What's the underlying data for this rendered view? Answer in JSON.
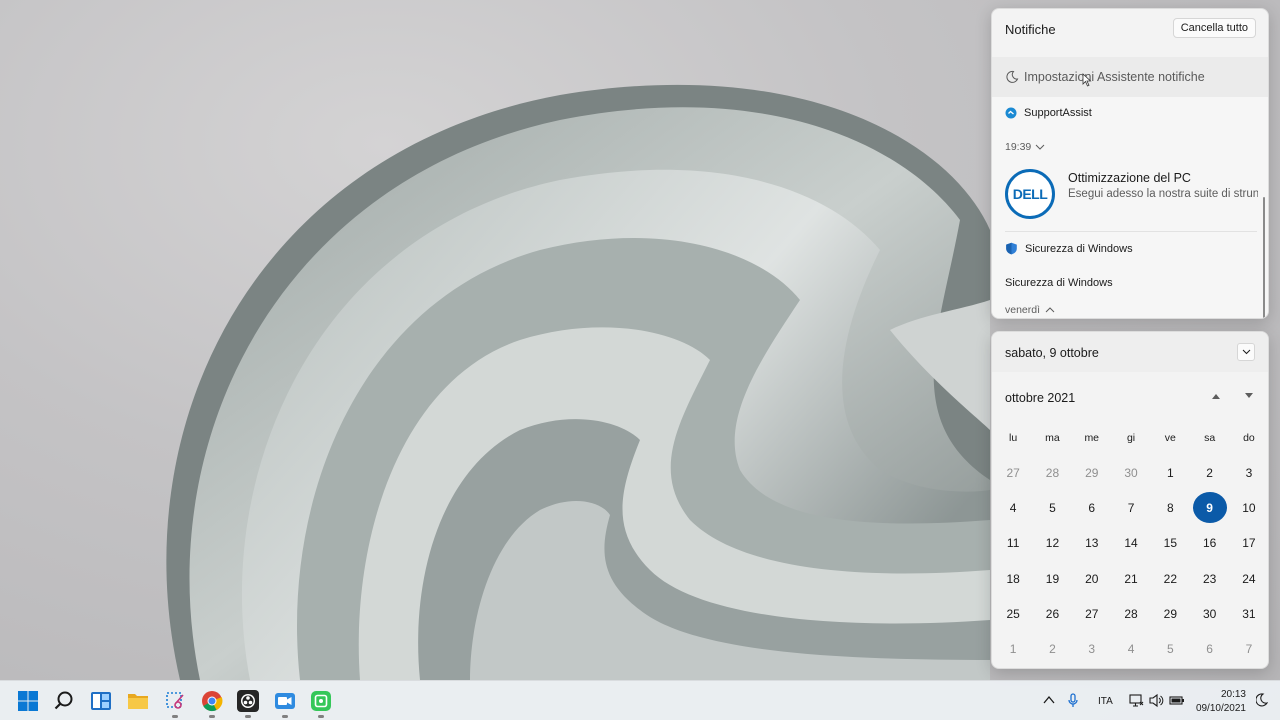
{
  "notifications": {
    "title": "Notifiche",
    "clear_all": "Cancella tutto",
    "focus_assist": "Impostazioni Assistente notifiche",
    "groups": [
      {
        "app": "SupportAssist",
        "time": "19:39",
        "title": "Ottimizzazione del PC",
        "text": "Esegui adesso la nostra suite di strun"
      },
      {
        "app": "Sicurezza di Windows",
        "subtitle": "Sicurezza di Windows",
        "day": "venerdì"
      }
    ]
  },
  "calendar": {
    "date_header": "sabato, 9 ottobre",
    "month": "ottobre 2021",
    "weekdays": [
      "lu",
      "ma",
      "me",
      "gi",
      "ve",
      "sa",
      "do"
    ],
    "weeks": [
      [
        "27",
        "28",
        "29",
        "30",
        "1",
        "2",
        "3"
      ],
      [
        "4",
        "5",
        "6",
        "7",
        "8",
        "9",
        "10"
      ],
      [
        "11",
        "12",
        "13",
        "14",
        "15",
        "16",
        "17"
      ],
      [
        "18",
        "19",
        "20",
        "21",
        "22",
        "23",
        "24"
      ],
      [
        "25",
        "26",
        "27",
        "28",
        "29",
        "30",
        "31"
      ],
      [
        "1",
        "2",
        "3",
        "4",
        "5",
        "6",
        "7"
      ]
    ],
    "today": "9"
  },
  "taskbar": {
    "apps": [
      "start-icon",
      "search-icon",
      "widgets-icon",
      "file-explorer-icon",
      "snipping-tool-icon",
      "chrome-icon",
      "obs-icon",
      "video-recorder-icon",
      "screen-capture-icon"
    ],
    "language": "ITA",
    "time": "20:13",
    "date": "09/10/2021"
  },
  "colors": {
    "accent": "#0b5aa8",
    "dell_blue": "#0b6bb7"
  }
}
